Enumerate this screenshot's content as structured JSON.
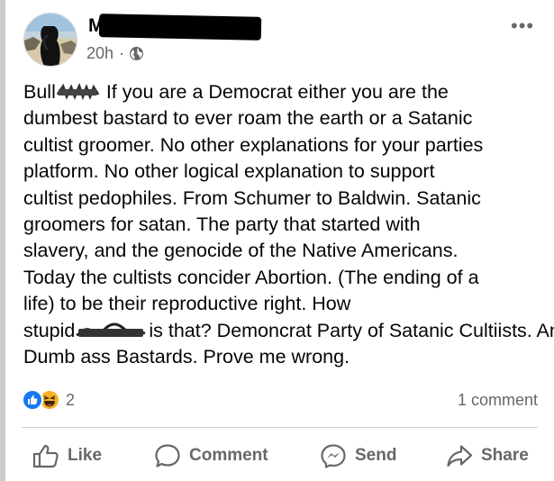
{
  "post": {
    "author": "M",
    "time": "20h",
    "separator": "·",
    "privacy_icon": "globe-icon",
    "more_icon": "more-horizontal-icon",
    "text_lines": [
      "Bull",
      " If you are a Democrat either you are the",
      "dumbest bastard to ever roam the earth or a Satanic",
      "cultist groomer. No other explanations for your parties",
      "platform. No other logical explanation to support",
      "cultist pedophiles. From Schumer to Baldwin. Satanic",
      "groomers for satan. The party that started with",
      "slavery, and the genocide of the Native Americans.",
      "Today the cultists concider Abortion. (The ending of a",
      "life) to be their reproductive right. How ",
      "stupid",
      "is that?  Demoncrat Party of Satanic Cultiists. And",
      "Dumb ass Bastards. Prove me wrong."
    ]
  },
  "engagement": {
    "reaction_icons": [
      "like-reaction-icon",
      "haha-reaction-icon"
    ],
    "reaction_count": "2",
    "comment_count": "1 comment"
  },
  "actions": {
    "like": "Like",
    "comment": "Comment",
    "send": "Send",
    "share": "Share"
  },
  "colors": {
    "accent": "#1877f2",
    "secondary_text": "#65676b",
    "haha": "#f7b125"
  }
}
